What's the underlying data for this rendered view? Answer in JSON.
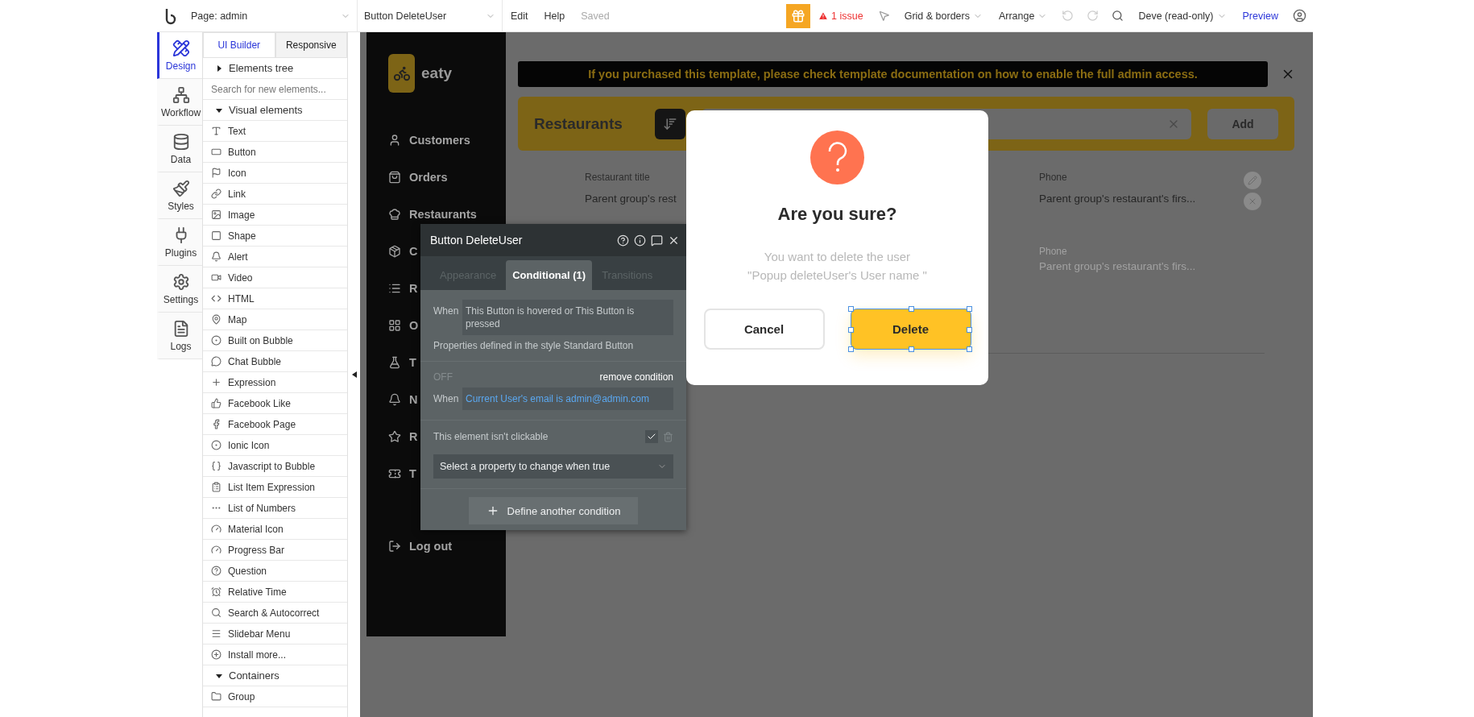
{
  "topbar": {
    "page_selector": "Page: admin",
    "element_selector": "Button DeleteUser",
    "menus": [
      "Edit",
      "Help"
    ],
    "save_status": "Saved",
    "issues": "1 issue",
    "grid_menu": "Grid & borders",
    "arrange_menu": "Arrange",
    "user_menu": "Deve (read-only)",
    "preview": "Preview"
  },
  "side_tabs": [
    {
      "label": "Design",
      "selected": true
    },
    {
      "label": "Workflow",
      "selected": false
    },
    {
      "label": "Data",
      "selected": false
    },
    {
      "label": "Styles",
      "selected": false
    },
    {
      "label": "Plugins",
      "selected": false
    },
    {
      "label": "Settings",
      "selected": false
    },
    {
      "label": "Logs",
      "selected": false
    }
  ],
  "panel": {
    "tabs": [
      {
        "label": "UI Builder",
        "selected": true
      },
      {
        "label": "Responsive",
        "selected": false
      }
    ],
    "elements_tree": {
      "label": "Elements tree",
      "expanded": false
    },
    "search": {
      "placeholder": "Search for new elements..."
    },
    "groups": [
      {
        "label": "Visual elements",
        "expanded": true,
        "items": [
          "Text",
          "Button",
          "Icon",
          "Link",
          "Image",
          "Shape",
          "Alert",
          "Video",
          "HTML",
          "Map",
          "Built on Bubble",
          "Chat Bubble",
          "Expression",
          "Facebook Like",
          "Facebook Page",
          "Ionic Icon",
          "Javascript to Bubble",
          "List Item Expression",
          "List of Numbers",
          "Material Icon",
          "Progress Bar",
          "Question",
          "Relative Time",
          "Search & Autocorrect",
          "Slidebar Menu",
          "Install more..."
        ]
      },
      {
        "label": "Containers",
        "expanded": true,
        "items": [
          "Group"
        ]
      }
    ]
  },
  "app": {
    "logo": "eaty",
    "nav": [
      {
        "label": "Customers"
      },
      {
        "label": "Orders"
      },
      {
        "label": "Restaurants"
      },
      {
        "label": "C"
      },
      {
        "label": "R"
      },
      {
        "label": "O"
      },
      {
        "label": "T"
      },
      {
        "label": "N"
      },
      {
        "label": "R"
      },
      {
        "label": "T"
      }
    ],
    "logout": "Log out",
    "banner": "If you purchased this template, please check template documentation on how to enable the full admin access.",
    "header": {
      "title": "Restaurants",
      "add": "Add"
    },
    "columns": [
      {
        "header": "Restaurant title",
        "value": "Parent group's rest"
      },
      {
        "header": "Phone",
        "value": "Parent group's restaurant's firs..."
      }
    ],
    "faint_row": {
      "header": "Phone",
      "value": "Parent group's restaurant's firs..."
    }
  },
  "inspector": {
    "title": "Button DeleteUser",
    "tabs": [
      {
        "label": "Appearance",
        "selected": false
      },
      {
        "label": "Conditional (1)",
        "selected": true
      },
      {
        "label": "Transitions",
        "selected": false
      }
    ],
    "conditions": [
      {
        "when_label": "When",
        "expression": "This Button is hovered or This Button is pressed",
        "note": "Properties defined in the style Standard Button"
      },
      {
        "status": "OFF",
        "remove": "remove condition",
        "when_label": "When",
        "expression": "Current User's email is admin@admin.com"
      }
    ],
    "property": {
      "label": "This element isn't clickable",
      "checked": true
    },
    "select": {
      "placeholder": "Select a property to change when true"
    },
    "add_button": "Define another condition"
  },
  "modal": {
    "title": "Are you sure?",
    "message_lines": [
      "You want to delete the user",
      "\"Popup deleteUser's User name \""
    ],
    "buttons": [
      {
        "label": "Cancel",
        "kind": "secondary",
        "selected": false
      },
      {
        "label": "Delete",
        "kind": "primary",
        "selected": true
      }
    ]
  }
}
